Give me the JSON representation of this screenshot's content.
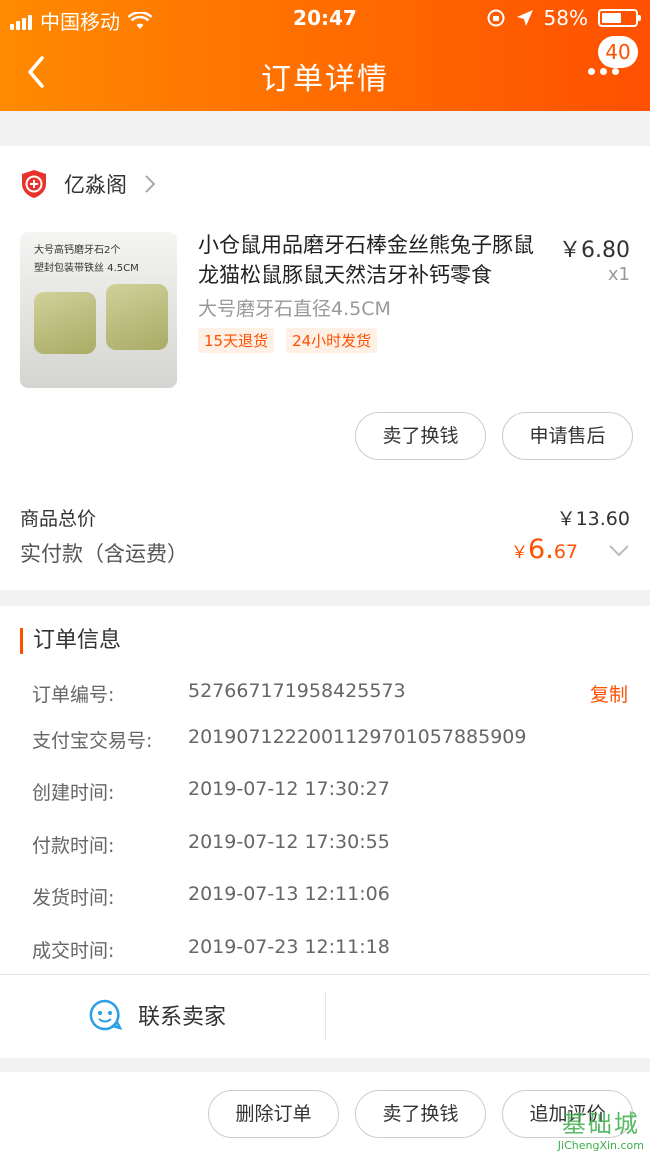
{
  "status_bar": {
    "carrier": "中国移动",
    "time": "20:47",
    "battery": "58%"
  },
  "nav": {
    "title": "订单详情",
    "badge": "40"
  },
  "shop": {
    "name": "亿淼阁"
  },
  "product": {
    "image_caption": "大号高钙磨牙石2个\n塑封包装带铁丝 4.5CM",
    "name": "小仓鼠用品磨牙石棒金丝熊兔子豚鼠龙猫松鼠豚鼠天然洁牙补钙零食",
    "price": "￥6.80",
    "quantity": "x1",
    "spec": "大号磨牙石直径4.5CM",
    "tags": [
      "15天退货",
      "24小时发货"
    ]
  },
  "product_actions": {
    "sell_label": "卖了换钱",
    "after_sale_label": "申请售后"
  },
  "summary": {
    "total_label": "商品总价",
    "total_value": "￥13.60",
    "paid_label": "实付款（含运费）",
    "paid_currency": "￥",
    "paid_int": "6.",
    "paid_dec": "67"
  },
  "order_info": {
    "title": "订单信息",
    "copy_label": "复制",
    "rows": [
      {
        "label": "订单编号:",
        "value": "527667171958425573"
      },
      {
        "label": "支付宝交易号:",
        "value": "2019071222001129701057885909"
      },
      {
        "label": "创建时间:",
        "value": "2019-07-12 17:30:27"
      },
      {
        "label": "付款时间:",
        "value": "2019-07-12 17:30:55"
      },
      {
        "label": "发货时间:",
        "value": "2019-07-13 12:11:06"
      },
      {
        "label": "成交时间:",
        "value": "2019-07-23 12:11:18"
      }
    ],
    "contact_label": "联系卖家"
  },
  "bottom_bar": {
    "delete_label": "删除订单",
    "sell_label": "卖了换钱",
    "review_label": "追加评价"
  },
  "watermark": {
    "main": "基础城",
    "sub": "JiChengXin.com"
  },
  "colors": {
    "accent": "#ff5000",
    "header_start": "#ff8a00"
  }
}
